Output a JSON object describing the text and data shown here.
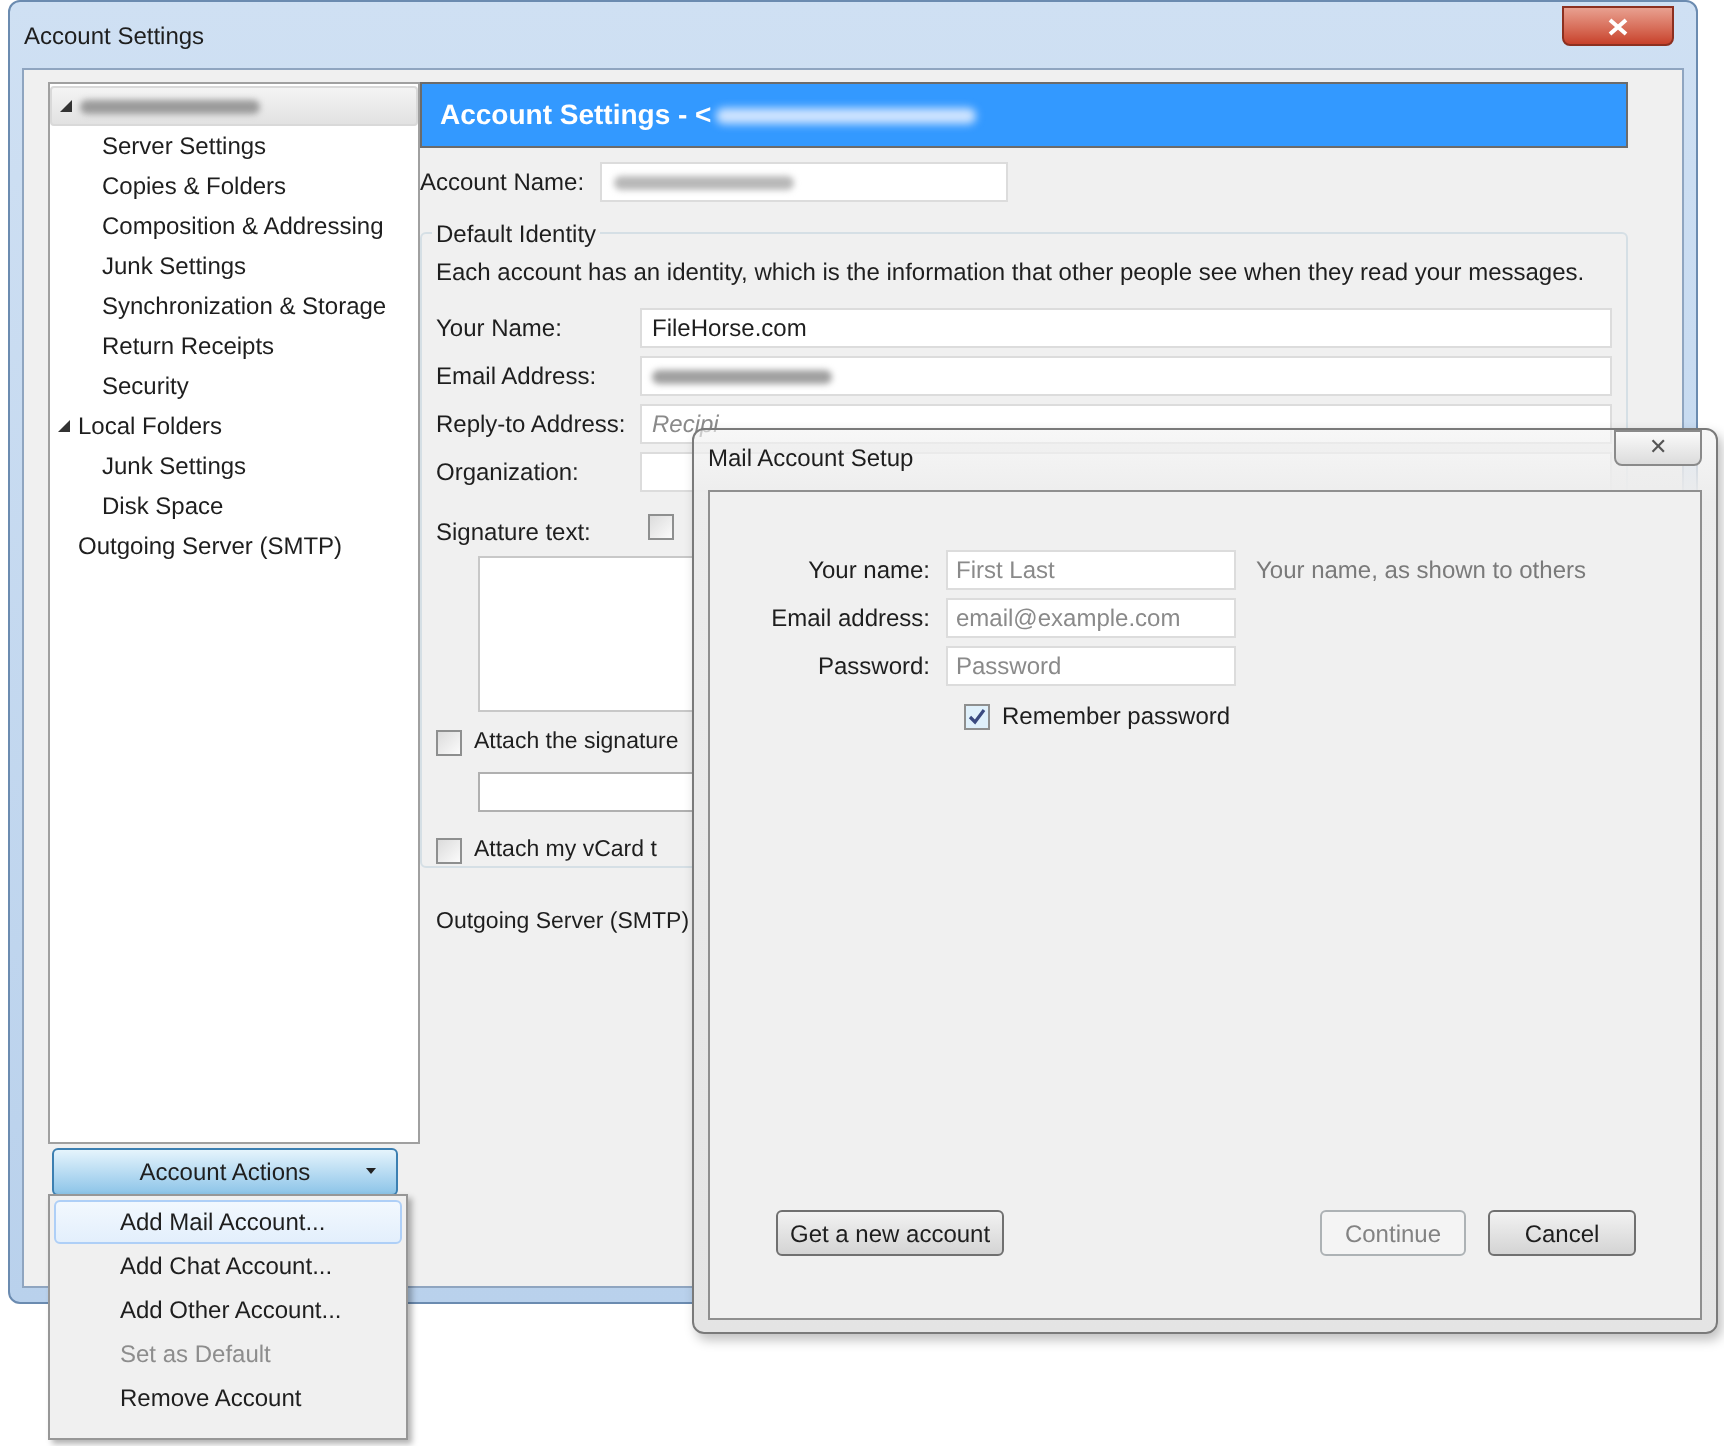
{
  "window": {
    "title": "Account Settings"
  },
  "sidebar": {
    "items": [
      {
        "kind": "blurred",
        "selected": true,
        "expanded": true,
        "children": [
          {
            "label": "Server Settings"
          },
          {
            "label": "Copies & Folders"
          },
          {
            "label": "Composition & Addressing"
          },
          {
            "label": "Junk Settings"
          },
          {
            "label": "Synchronization & Storage"
          },
          {
            "label": "Return Receipts"
          },
          {
            "label": "Security"
          }
        ]
      },
      {
        "label": "Local Folders",
        "selected": false,
        "expanded": true,
        "children": [
          {
            "label": "Junk Settings"
          },
          {
            "label": "Disk Space"
          }
        ]
      },
      {
        "label": "Outgoing Server (SMTP)",
        "selected": false
      }
    ]
  },
  "account_actions": {
    "label": "Account Actions",
    "expanded": true
  },
  "menu": [
    {
      "label": "Add Mail Account...",
      "selected": true,
      "disabled": false
    },
    {
      "label": "Add Chat Account...",
      "selected": false,
      "disabled": false
    },
    {
      "label": "Add Other Account...",
      "selected": false,
      "disabled": false
    },
    {
      "label": "Set as Default",
      "selected": false,
      "disabled": true
    },
    {
      "label": "Remove Account",
      "selected": false,
      "disabled": false
    }
  ],
  "panel": {
    "header": "Account Settings - <",
    "account_name": {
      "label": "Account Name:",
      "kind": "blurred"
    },
    "identity": {
      "legend": "Default Identity",
      "description": "Each account has an identity, which is the information that other people see when they read your messages.",
      "fields": [
        {
          "label": "Your Name:",
          "kind": "text",
          "value": "FileHorse.com"
        },
        {
          "label": "Email Address:",
          "kind": "blurred"
        },
        {
          "label": "Reply-to Address:",
          "kind": "text",
          "placeholder": "Recipi"
        },
        {
          "label": "Organization:",
          "kind": "text"
        }
      ],
      "signature": {
        "label": "Signature text:",
        "option": {
          "checked": false
        }
      },
      "attach_signature": {
        "label": "Attach the signature",
        "checked": false
      },
      "attach_vcard": {
        "label": "Attach my vCard t",
        "checked": false
      },
      "outgoing": {
        "label": "Outgoing Server (SMTP)"
      }
    }
  },
  "dialog": {
    "title": "Mail Account Setup",
    "close": "✕",
    "fields": [
      {
        "label": "Your name:",
        "placeholder": "First Last",
        "hint": "Your name, as shown to others"
      },
      {
        "label": "Email address:",
        "placeholder": "email@example.com"
      },
      {
        "label": "Password:",
        "placeholder": "Password"
      }
    ],
    "remember": {
      "label": "Remember password",
      "checked": true
    },
    "buttons": [
      {
        "label": "Get a new account",
        "disabled": false
      },
      {
        "label": "Continue",
        "disabled": true
      },
      {
        "label": "Cancel",
        "disabled": false
      }
    ]
  }
}
